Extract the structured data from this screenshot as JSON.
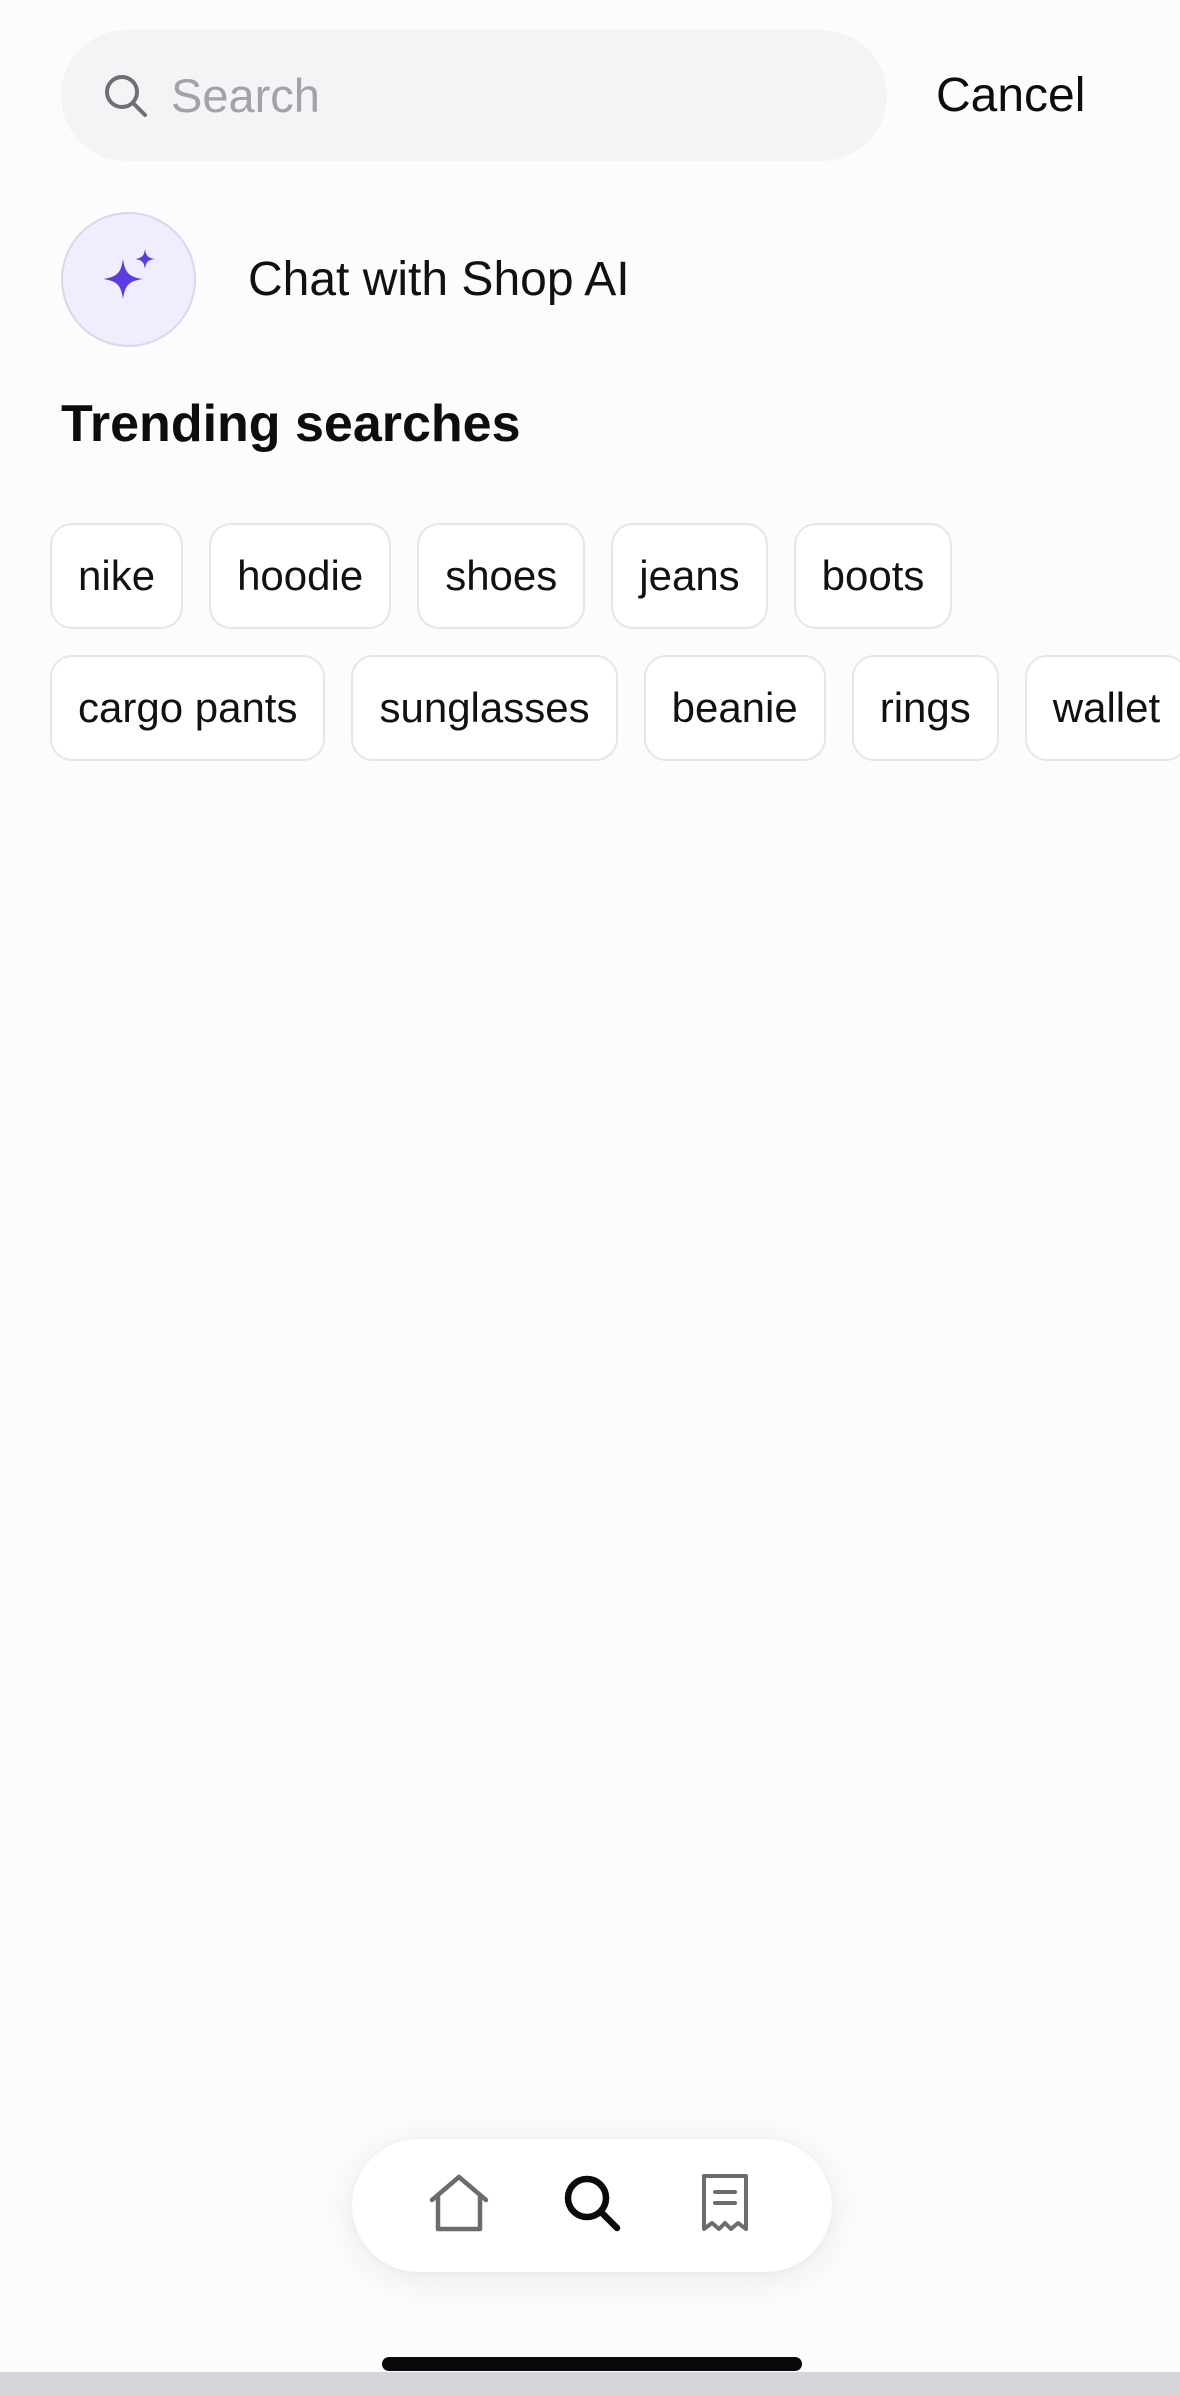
{
  "search": {
    "placeholder": "Search",
    "value": "",
    "icon": "search-icon"
  },
  "header": {
    "cancel_label": "Cancel"
  },
  "chat": {
    "label": "Chat with Shop AI",
    "icon": "sparkle-icon",
    "accent_color": "#5b3be3"
  },
  "trending": {
    "title": "Trending searches",
    "row1": [
      "nike",
      "hoodie",
      "shoes",
      "jeans",
      "boots"
    ],
    "row2": [
      "cargo pants",
      "sunglasses",
      "beanie",
      "rings",
      "wallet"
    ]
  },
  "tab_bar": {
    "items": [
      {
        "icon": "home-icon",
        "active": false
      },
      {
        "icon": "search-icon",
        "active": true
      },
      {
        "icon": "receipt-icon",
        "active": false
      }
    ]
  }
}
